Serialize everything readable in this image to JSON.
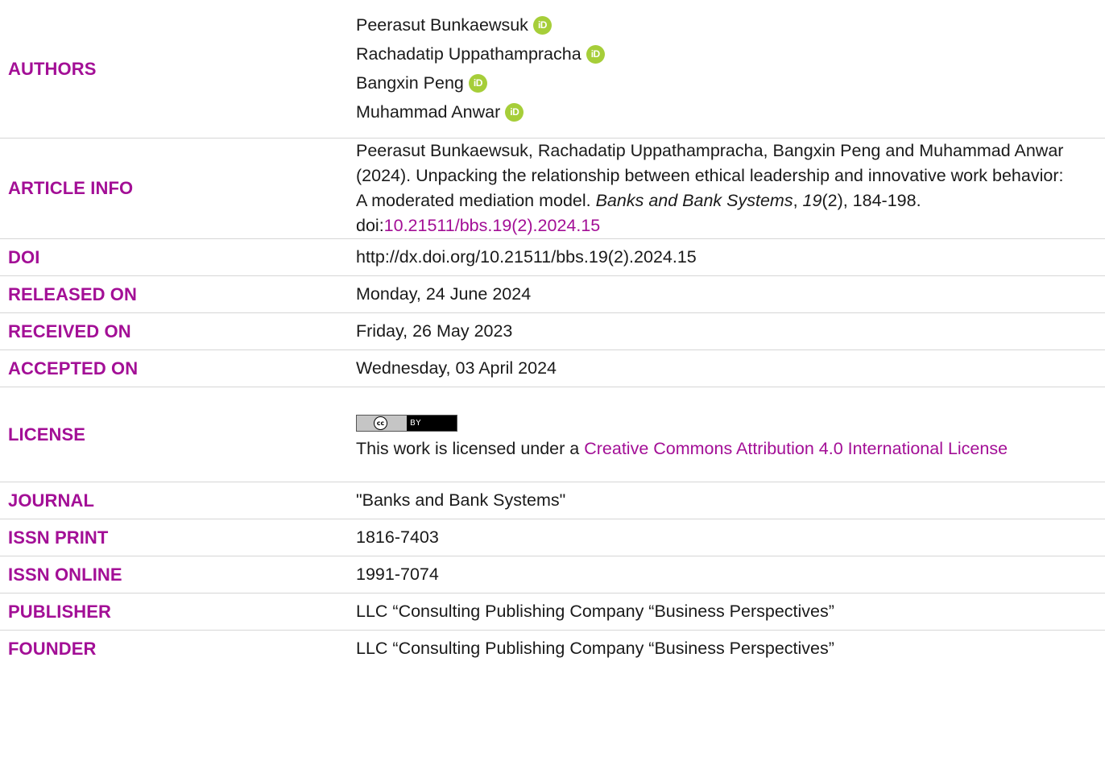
{
  "authors": {
    "label": "AUTHORS",
    "names": [
      "Peerasut Bunkaewsuk",
      "Rachadatip Uppathampracha",
      "Bangxin Peng",
      "Muhammad Anwar"
    ],
    "orcid_icon_text": "iD"
  },
  "article_info": {
    "label": "ARTICLE INFO",
    "citation_text": "Peerasut Bunkaewsuk, Rachadatip Uppathampracha, Bangxin Peng and Muhammad Anwar (2024). Unpacking the relationship between ethical leadership and innovative work behavior: A moderated mediation model. ",
    "journal_italic": "Banks and Bank Systems",
    "sep1": ", ",
    "volume_italic": "19",
    "issue_pages": "(2), 184-198. doi:",
    "doi_link": "10.21511/bbs.19(2).2024.15"
  },
  "doi": {
    "label": "DOI",
    "value": "http://dx.doi.org/10.21511/bbs.19(2).2024.15"
  },
  "released": {
    "label": "RELEASED ON",
    "value": "Monday, 24 June 2024"
  },
  "received": {
    "label": "RECEIVED ON",
    "value": "Friday, 26 May 2023"
  },
  "accepted": {
    "label": "ACCEPTED ON",
    "value": "Wednesday, 03 April 2024"
  },
  "license": {
    "label": "LICENSE",
    "badge_cc": "cc",
    "badge_by": "BY",
    "text": "This work is licensed under a ",
    "link_text": "Creative Commons Attribution 4.0 International License"
  },
  "journal": {
    "label": "JOURNAL",
    "value": "\"Banks and Bank Systems\""
  },
  "issn_print": {
    "label": "ISSN PRINT",
    "value": "1816-7403"
  },
  "issn_online": {
    "label": "ISSN ONLINE",
    "value": "1991-7074"
  },
  "publisher": {
    "label": "PUBLISHER",
    "value": "LLC “Consulting Publishing Company “Business Perspectives”"
  },
  "founder": {
    "label": "FOUNDER",
    "value": "LLC “Consulting Publishing Company “Business Perspectives”"
  },
  "colors": {
    "label_magenta": "#a30f96",
    "orcid_green": "#a6ce39",
    "divider": "#d6d6d6"
  }
}
